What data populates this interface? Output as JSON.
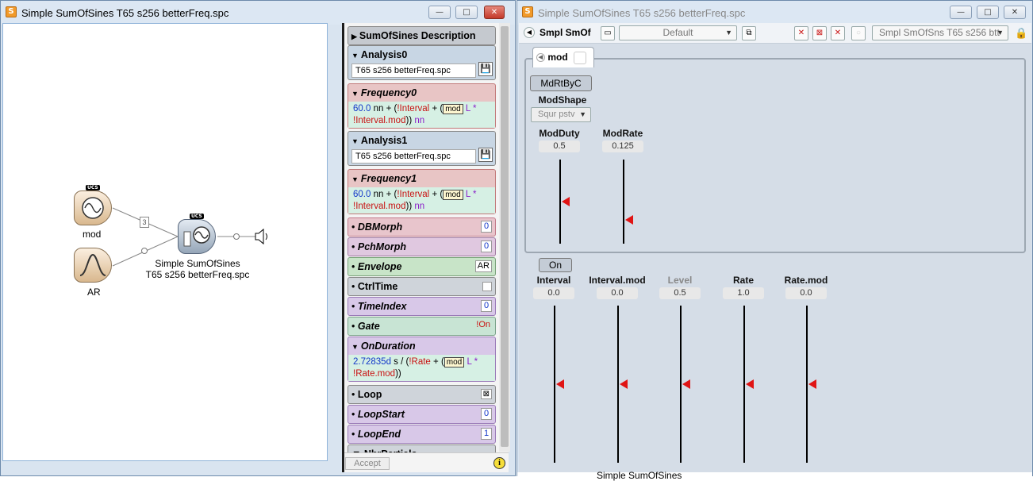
{
  "left_window": {
    "title": "Simple SumOfSines T65 s256 betterFreq.spc",
    "controls": {
      "minimize": "—",
      "maximize": "□",
      "close": "✕"
    },
    "nodes": {
      "badge": "UCS",
      "mod_label": "mod",
      "ar_label": "AR",
      "main_label_line1": "Simple SumOfSines",
      "main_label_line2": "T65 s256 betterFreq.spc",
      "connector_count": "3"
    },
    "panels": {
      "description": "SumOfSines Description",
      "analysis0": {
        "title": "Analysis0",
        "file": "T65 s256 betterFreq.spc"
      },
      "frequency0": {
        "title": "Frequency0",
        "value": "60.0",
        "unit": "nn",
        "interval": "!Interval",
        "mod": "mod",
        "L": "L",
        "times": "*",
        "interval_mod": "!Interval.mod",
        "unit2": "nn"
      },
      "analysis1": {
        "title": "Analysis1",
        "file": "T65 s256 betterFreq.spc"
      },
      "frequency1": {
        "title": "Frequency1",
        "value": "60.0",
        "unit": "nn",
        "interval": "!Interval",
        "mod": "mod",
        "L": "L",
        "times": "*",
        "interval_mod": "!Interval.mod",
        "unit2": "nn"
      },
      "dbmorph": {
        "title": "DBMorph",
        "value": "0"
      },
      "pchmorph": {
        "title": "PchMorph",
        "value": "0"
      },
      "envelope": {
        "title": "Envelope",
        "value": "AR"
      },
      "ctrltime": {
        "title": "CtrlTime"
      },
      "timeindex": {
        "title": "TimeIndex",
        "value": "0"
      },
      "gate": {
        "title": "Gate",
        "value": "!On"
      },
      "onduration": {
        "title": "OnDuration",
        "value": "2.72835d",
        "unit": "s",
        "rate": "!Rate",
        "mod": "mod",
        "L": "L",
        "times": "*",
        "rate_mod": "!Rate.mod"
      },
      "loop": {
        "title": "Loop",
        "value": "⊠"
      },
      "loopstart": {
        "title": "LoopStart",
        "value": "0"
      },
      "loopend": {
        "title": "LoopEnd",
        "value": "1"
      },
      "nbrpartials": {
        "title": "NbrPartials"
      }
    },
    "accept_label": "Accept",
    "info_label": "i"
  },
  "right_window": {
    "title": "Simple SumOfSines T65 s256 betterFreq.spc",
    "controls": {
      "minimize": "—",
      "maximize": "□",
      "close": "✕"
    },
    "toolbar": {
      "name": "Smpl SmOf",
      "preset": "Default",
      "sound_select": "Smpl SmOfSns T65 s256 btt"
    },
    "mod_tab": "mod",
    "mod_group": {
      "button": "MdRtByC",
      "shape_label": "ModShape",
      "shape_value": "Squr pstv",
      "faders": [
        {
          "label": "ModDuty",
          "value": "0.5",
          "level": 0.5
        },
        {
          "label": "ModRate",
          "value": "0.125",
          "level": 0.285
        }
      ]
    },
    "on_button": "On",
    "faders": [
      {
        "label": "Interval",
        "value": "0.0",
        "level": 0.5,
        "muted": false
      },
      {
        "label": "Interval.mod",
        "value": "0.0",
        "level": 0.5,
        "muted": false
      },
      {
        "label": "Level",
        "value": "0.5",
        "level": 0.5,
        "muted": true
      },
      {
        "label": "Rate",
        "value": "1.0",
        "level": 0.5,
        "muted": false
      },
      {
        "label": "Rate.mod",
        "value": "0.0",
        "level": 0.5,
        "muted": false
      }
    ],
    "bottom_text": "Simple SumOfSines"
  }
}
